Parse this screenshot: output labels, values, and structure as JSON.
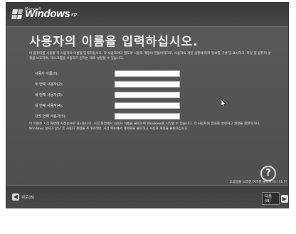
{
  "header": {
    "brand_small": "Microsoft",
    "brand": "Windows",
    "brand_suffix": "xp"
  },
  "page_title": "사용자의 이름을 입력하십시오.",
  "intro_text": "이 컴퓨터를 사용할 각 사용자의 이름을 입력하십시오. 각 사용자마다 별도의 사용자 계정이 만들어지므로, 사용자의 개인 설정에 따라 정보를 구성 및 표시하고, 파일 및 컴퓨터 설정을 보호하며, 데스크톱을 사용자가 원하는 대로 설정할 수 있습니다.",
  "form": {
    "fields": [
      {
        "label": "사용자 이름(Y):",
        "value": "",
        "name": "user-name-field"
      },
      {
        "label": "두 번째 사용자(2):",
        "value": "",
        "name": "second-user-field"
      },
      {
        "label": "세 번째 사용자(3):",
        "value": "",
        "name": "third-user-field"
      },
      {
        "label": "네 번째 사용자(4):",
        "value": "",
        "name": "fourth-user-field"
      },
      {
        "label": "다섯 번째 사용자(5):",
        "value": "",
        "name": "fifth-user-field"
      }
    ]
  },
  "outro_text": "이 이름은 시작 화면에 사전순으로 표시됩니다. 시작 화면에서 사용자 이름을 클릭하여 Windows를 시작할 수 있습니다. 각 사용자의 암호를 설정하고 권한을 제한하거나, Windows 설치가 끝난 후 사용자 계정을 추가하려면, 시작 메뉴에서 제어판을 클릭하고 사용자 계정을 클릭하십시오.",
  "help": {
    "icon": "?",
    "text": "도움말을 보려면 여기를 클릭하거나 F1 키를 누르십시오."
  },
  "nav": {
    "back_label": "뒤로(B)",
    "next_label": "다음(N)",
    "back_arrow": "◀",
    "next_arrow": "▶"
  }
}
